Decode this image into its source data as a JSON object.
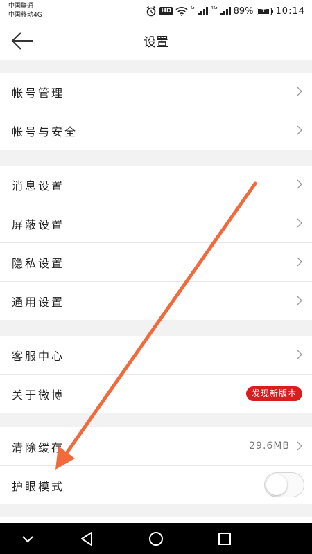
{
  "status_bar": {
    "carrier1": "中国联通",
    "carrier2": "中国移动4G",
    "hd": "HD",
    "sig1_label": "G",
    "sig2_label": "4G",
    "battery": "89%",
    "time": "10:14"
  },
  "header": {
    "title": "设置"
  },
  "groups": [
    {
      "items": [
        {
          "label": "帐号管理"
        },
        {
          "label": "帐号与安全"
        }
      ]
    },
    {
      "items": [
        {
          "label": "消息设置"
        },
        {
          "label": "屏蔽设置"
        },
        {
          "label": "隐私设置"
        },
        {
          "label": "通用设置"
        }
      ]
    },
    {
      "items": [
        {
          "label": "客服中心"
        },
        {
          "label": "关于微博",
          "badge": "发现新版本"
        }
      ]
    },
    {
      "items": [
        {
          "label": "清除缓存",
          "value": "29.6MB"
        },
        {
          "label": "护眼模式",
          "toggle_on": false
        }
      ]
    }
  ],
  "colors": {
    "badge": "#d81e1e",
    "annotation_arrow": "#f26a3c",
    "nav_background": "#000000"
  },
  "icons": {
    "back": "arrow-left-icon",
    "chevron": "chevron-right-icon",
    "nav": [
      "chevron-down-icon",
      "triangle-back-icon",
      "circle-home-icon",
      "square-recents-icon"
    ]
  }
}
